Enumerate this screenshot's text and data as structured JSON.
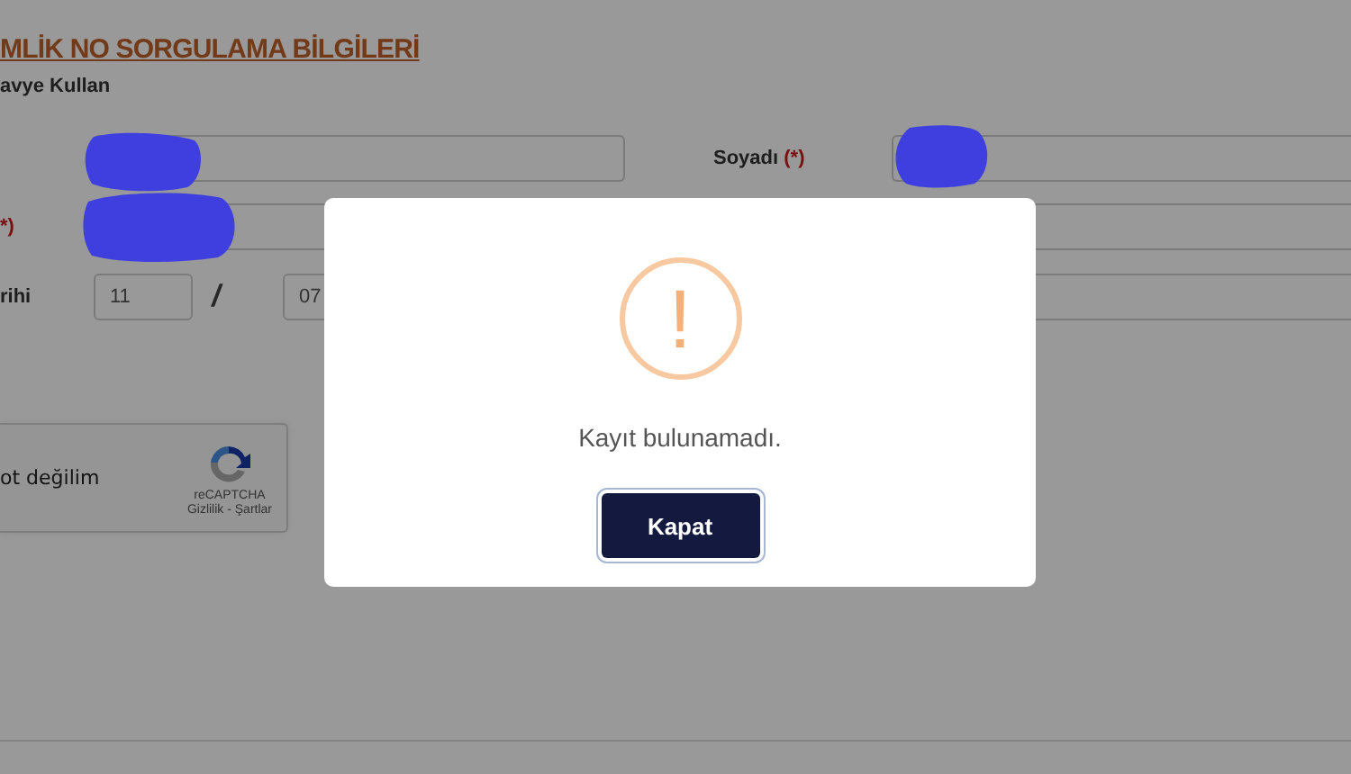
{
  "form": {
    "title": "MLİK NO SORGULAMA BİLGİLERİ",
    "option_label": "avye Kullan",
    "name_row": {
      "surname_label": "Soyadı",
      "surname_required_mark": "(*)"
    },
    "second_row": {
      "required_mark": "*)"
    },
    "date_row": {
      "label": "rihi",
      "day": "11",
      "separator": "/",
      "month": "07"
    },
    "captcha": {
      "label": "ot değilim",
      "brand": "reCAPTCHA",
      "links": "Gizlilik - Şartlar"
    }
  },
  "dialog": {
    "icon": "!",
    "message": "Kayıt bulunamadı.",
    "button": "Kapat"
  }
}
